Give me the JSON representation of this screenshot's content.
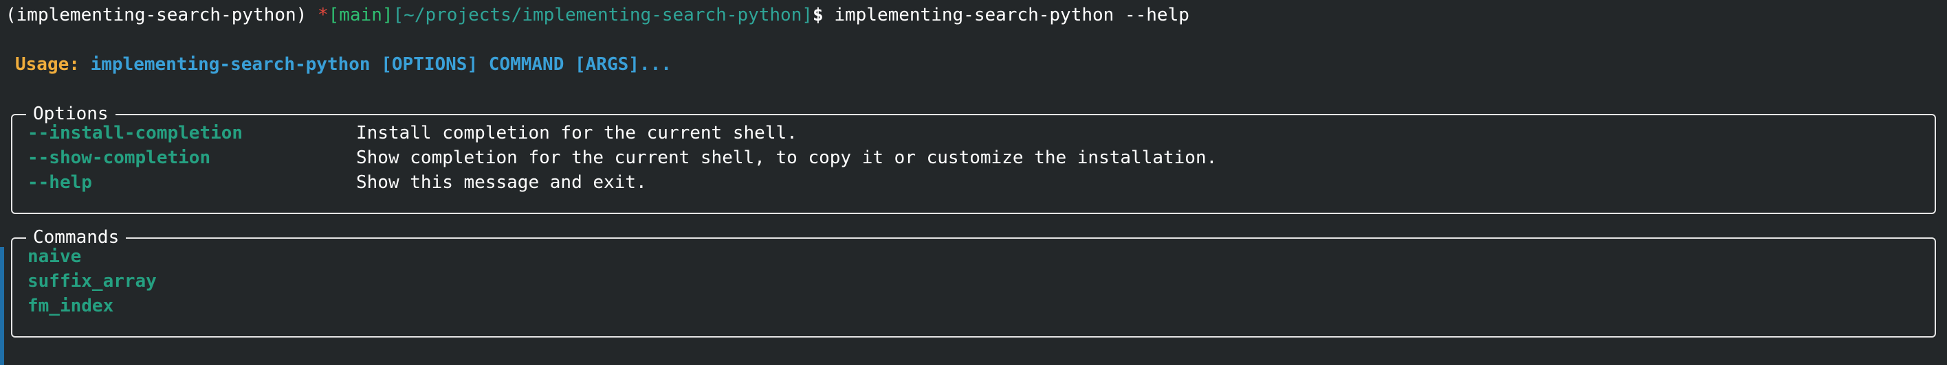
{
  "prompt": {
    "env": "(implementing-search-python)",
    "dirty_marker": "*",
    "branch": "[main]",
    "path": "[~/projects/implementing-search-python]",
    "symbol": "$",
    "command": "implementing-search-python --help"
  },
  "usage": {
    "label": "Usage:",
    "program": "implementing-search-python",
    "args": "[OPTIONS] COMMAND [ARGS]..."
  },
  "options_panel": {
    "title": "Options",
    "items": [
      {
        "name": "--install-completion",
        "description": "Install completion for the current shell."
      },
      {
        "name": "--show-completion",
        "description": "Show completion for the current shell, to copy it or customize the installation."
      },
      {
        "name": "--help",
        "description": "Show this message and exit."
      }
    ]
  },
  "commands_panel": {
    "title": "Commands",
    "items": [
      {
        "name": "naive"
      },
      {
        "name": "suffix_array"
      },
      {
        "name": "fm_index"
      }
    ]
  },
  "colors": {
    "background": "#232729",
    "usage_label": "#f0ad3c",
    "usage_program": "#3aa0d8",
    "option_name": "#25a081",
    "branch": "#2fbf71",
    "path": "#2fa598",
    "dirty_marker": "#e2483d"
  }
}
